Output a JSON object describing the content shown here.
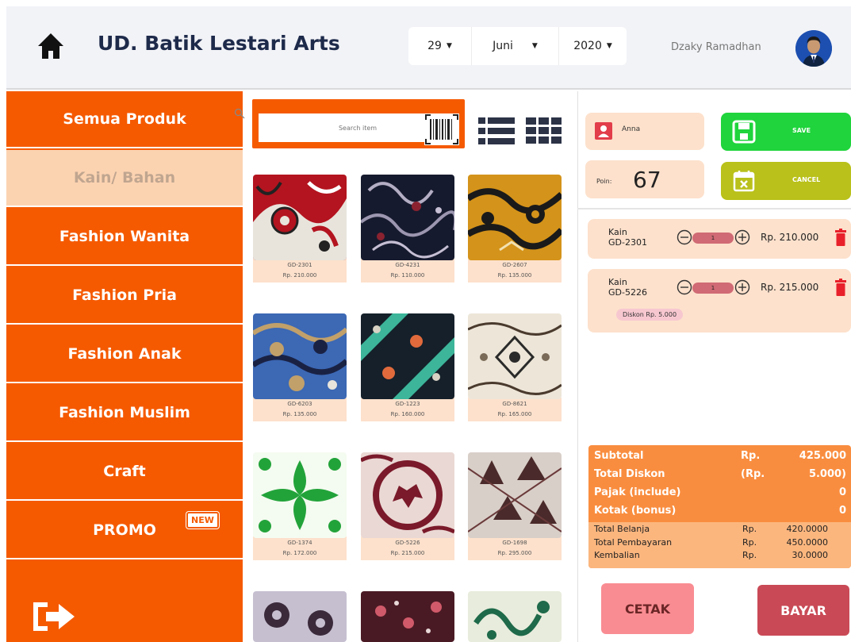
{
  "header": {
    "title": "UD. Batik Lestari Arts",
    "date": {
      "day": "29",
      "month": "Juni",
      "year": "2020"
    },
    "user_name": "Dzaky Ramadhan"
  },
  "sidebar": {
    "items": [
      {
        "label": "Semua Produk"
      },
      {
        "label": "Kain/ Bahan"
      },
      {
        "label": "Fashion Wanita"
      },
      {
        "label": "Fashion Pria"
      },
      {
        "label": "Fashion Anak"
      },
      {
        "label": "Fashion Muslim"
      },
      {
        "label": "Craft"
      },
      {
        "label": "PROMO"
      }
    ],
    "new_badge": "NEW"
  },
  "search": {
    "placeholder": "Search item"
  },
  "products": [
    {
      "code": "GD-2301",
      "price": "Rp. 210.000"
    },
    {
      "code": "GD-4231",
      "price": "Rp. 110.000"
    },
    {
      "code": "GD-2607",
      "price": "Rp. 135.000"
    },
    {
      "code": "GD-6203",
      "price": "Rp. 135.000"
    },
    {
      "code": "GD-1223",
      "price": "Rp. 160.000"
    },
    {
      "code": "GD-8621",
      "price": "Rp. 165.000"
    },
    {
      "code": "GD-1374",
      "price": "Rp. 172.000"
    },
    {
      "code": "GD-5226",
      "price": "Rp. 215.000"
    },
    {
      "code": "GD-1698",
      "price": "Rp. 295.000"
    }
  ],
  "customer": {
    "name": "Anna",
    "poin_label": "Poin:",
    "poin_value": "67"
  },
  "actions": {
    "save": "SAVE",
    "cancel": "CANCEL",
    "cetak": "CETAK",
    "bayar": "BAYAR"
  },
  "cart": [
    {
      "category": "Kain",
      "code": "GD-2301",
      "qty": "1",
      "price": "Rp. 210.000",
      "discount": ""
    },
    {
      "category": "Kain",
      "code": "GD-5226",
      "qty": "1",
      "price": "Rp. 215.000",
      "discount": "Diskon Rp. 5.000"
    }
  ],
  "summary": {
    "top": [
      {
        "label": "Subtotal",
        "currency": "Rp.",
        "value": "425.000"
      },
      {
        "label": "Total Diskon",
        "currency": "(Rp.",
        "value": "5.000)"
      },
      {
        "label": "Pajak (include)",
        "currency": "",
        "value": "0"
      },
      {
        "label": "Kotak (bonus)",
        "currency": "",
        "value": "0"
      }
    ],
    "bottom": [
      {
        "label": "Total Belanja",
        "currency": "Rp.",
        "value": "420.0000"
      },
      {
        "label": "Total Pembayaran",
        "currency": "Rp.",
        "value": "450.0000"
      },
      {
        "label": "Kembalian",
        "currency": "Rp.",
        "value": "30.0000"
      }
    ]
  },
  "colors": {
    "brand_orange": "#f55a00",
    "active_category": "#fcd3b1",
    "card_peach": "#fde1cc",
    "save_green": "#1fd43c",
    "cancel_olive": "#b9c11a",
    "cetak_pink": "#f98c92",
    "bayar_red": "#c94a56"
  },
  "icons": [
    "home-icon",
    "search-icon",
    "barcode-icon",
    "list-view-icon",
    "grid-view-icon",
    "person-icon",
    "save-icon",
    "calendar-cancel-icon",
    "minus-circle-icon",
    "plus-circle-icon",
    "trash-icon",
    "logout-icon"
  ]
}
